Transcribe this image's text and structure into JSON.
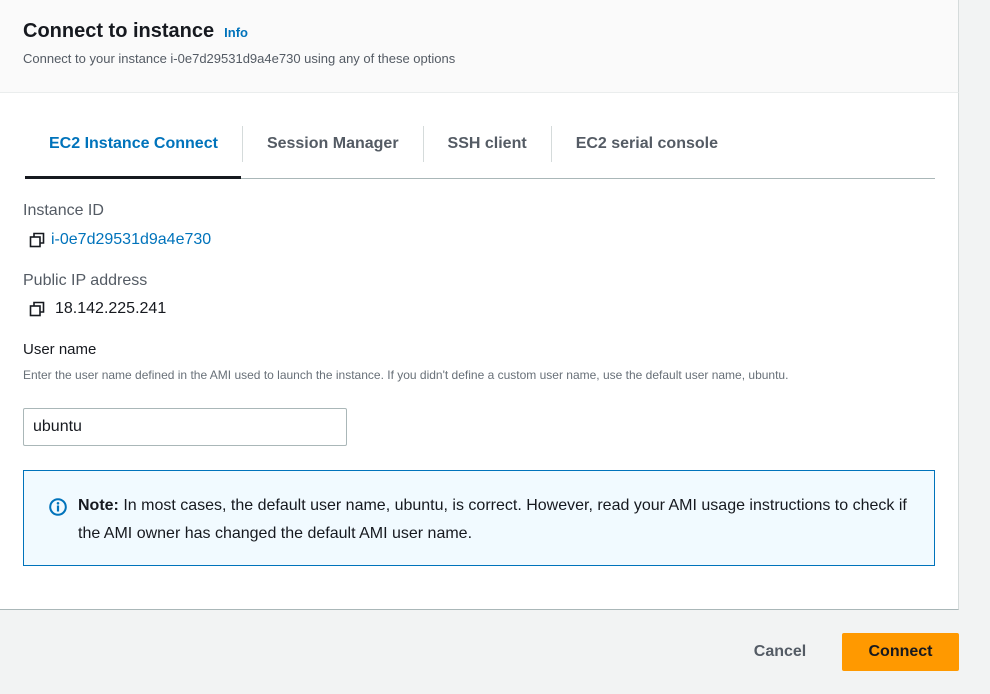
{
  "header": {
    "title": "Connect to instance",
    "info_label": "Info",
    "subtitle": "Connect to your instance i-0e7d29531d9a4e730 using any of these options"
  },
  "tabs": [
    {
      "label": "EC2 Instance Connect",
      "active": true
    },
    {
      "label": "Session Manager",
      "active": false
    },
    {
      "label": "SSH client",
      "active": false
    },
    {
      "label": "EC2 serial console",
      "active": false
    }
  ],
  "instance": {
    "id_label": "Instance ID",
    "id_value": "i-0e7d29531d9a4e730",
    "ip_label": "Public IP address",
    "ip_value": "18.142.225.241"
  },
  "username": {
    "label": "User name",
    "description": "Enter the user name defined in the AMI used to launch the instance. If you didn't define a custom user name, use the default user name, ubuntu.",
    "value": "ubuntu"
  },
  "note": {
    "bold": "Note:",
    "text": " In most cases, the default user name, ubuntu, is correct. However, read your AMI usage instructions to check if the AMI owner has changed the default AMI user name."
  },
  "footer": {
    "cancel_label": "Cancel",
    "connect_label": "Connect"
  },
  "colors": {
    "accent": "#0073bb",
    "primary_button": "#ff9900",
    "note_bg": "#f1faff"
  },
  "icons": {
    "copy": "copy-icon",
    "info": "info-circle-icon"
  }
}
